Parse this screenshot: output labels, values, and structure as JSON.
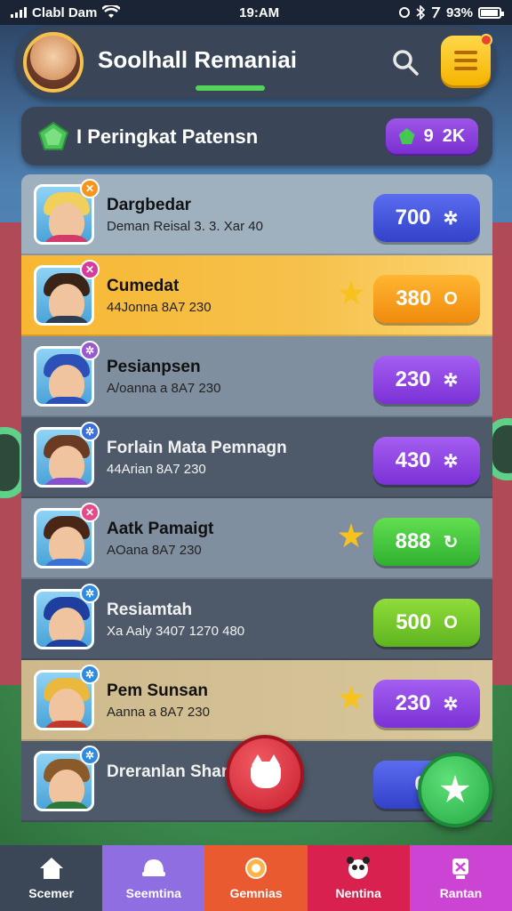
{
  "status_bar": {
    "carrier": "Clabl Dam",
    "time": "19:AM",
    "battery": "93%",
    "battery_level": 0.93
  },
  "header": {
    "title": "Soolhall Remaniai"
  },
  "rank_bar": {
    "title": "I Peringkat Patensn",
    "gem_count": "9",
    "gem_extra": "2K"
  },
  "leaderboard": [
    {
      "name": "Dargbedar",
      "sub": "Deman Reisal 3. 3. Xar 40",
      "score": "700",
      "score_icon": "✲",
      "style": "light",
      "pill": "blue",
      "star": false,
      "badge_color": "#f7941d",
      "badge": "✕",
      "hair": "#f0cf5a",
      "shirt": "#d33b6a"
    },
    {
      "name": "Cumedat",
      "sub": "44Jonna 8A7 230",
      "score": "380",
      "score_icon": "O",
      "style": "gold",
      "pill": "orange",
      "star": true,
      "badge_color": "#d63c9c",
      "badge": "✕",
      "hair": "#3a2418",
      "shirt": "#2c3e50"
    },
    {
      "name": "Pesianpsen",
      "sub": "A/oanna a 8A7 230",
      "score": "230",
      "score_icon": "✲",
      "style": "gray",
      "pill": "purple",
      "star": false,
      "badge_color": "#9b59d0",
      "badge": "✲",
      "hair": "#2d4fb8",
      "shirt": "#2d4fb8"
    },
    {
      "name": "Forlain Mata Pemnagn",
      "sub": "44Arian 8A7 230",
      "score": "430",
      "score_icon": "✲",
      "style": "dark",
      "pill": "purple",
      "star": false,
      "badge_color": "#3b6fd9",
      "badge": "✲",
      "hair": "#6b3a22",
      "shirt": "#8a4fd0"
    },
    {
      "name": "Aatk Pamaigt",
      "sub": "AOana 8A7 230",
      "score": "888",
      "score_icon": "↻",
      "style": "gray",
      "pill": "green",
      "star": true,
      "badge_color": "#e64a8a",
      "badge": "✕",
      "hair": "#4a2616",
      "shirt": "#3a6fd6"
    },
    {
      "name": "Resiamtah",
      "sub": "Xa Aaly 3407 1270 480",
      "score": "500",
      "score_icon": "O",
      "style": "dark",
      "pill": "lime",
      "star": false,
      "badge_color": "#2f8be0",
      "badge": "✲",
      "hair": "#1f3fa0",
      "shirt": "#1f3fa0"
    },
    {
      "name": "Pem Sunsan",
      "sub": "Aanna a 8A7 230",
      "score": "230",
      "score_icon": "✲",
      "style": "cream",
      "pill": "purple",
      "star": true,
      "badge_color": "#2f8be0",
      "badge": "✲",
      "hair": "#e9b83c",
      "shirt": "#c0392b"
    },
    {
      "name": "Dreranlan Shar 3B",
      "sub": "",
      "score": "0",
      "score_icon": "",
      "style": "dark",
      "pill": "blue",
      "star": false,
      "badge_color": "#2f8be0",
      "badge": "✲",
      "hair": "#8a5a2a",
      "shirt": "#2c7a3a"
    }
  ],
  "bottom_nav": [
    {
      "label": "Scemer",
      "icon": "home-icon"
    },
    {
      "label": "Seemtina",
      "icon": "hat-icon"
    },
    {
      "label": "Gemnias",
      "icon": "globe-icon"
    },
    {
      "label": "Nentina",
      "icon": "panda-icon"
    },
    {
      "label": "Rantan",
      "icon": "trophy-icon"
    }
  ],
  "colors": {
    "accent_green": "#53d35b",
    "menu_yellow": "#f5b400"
  }
}
